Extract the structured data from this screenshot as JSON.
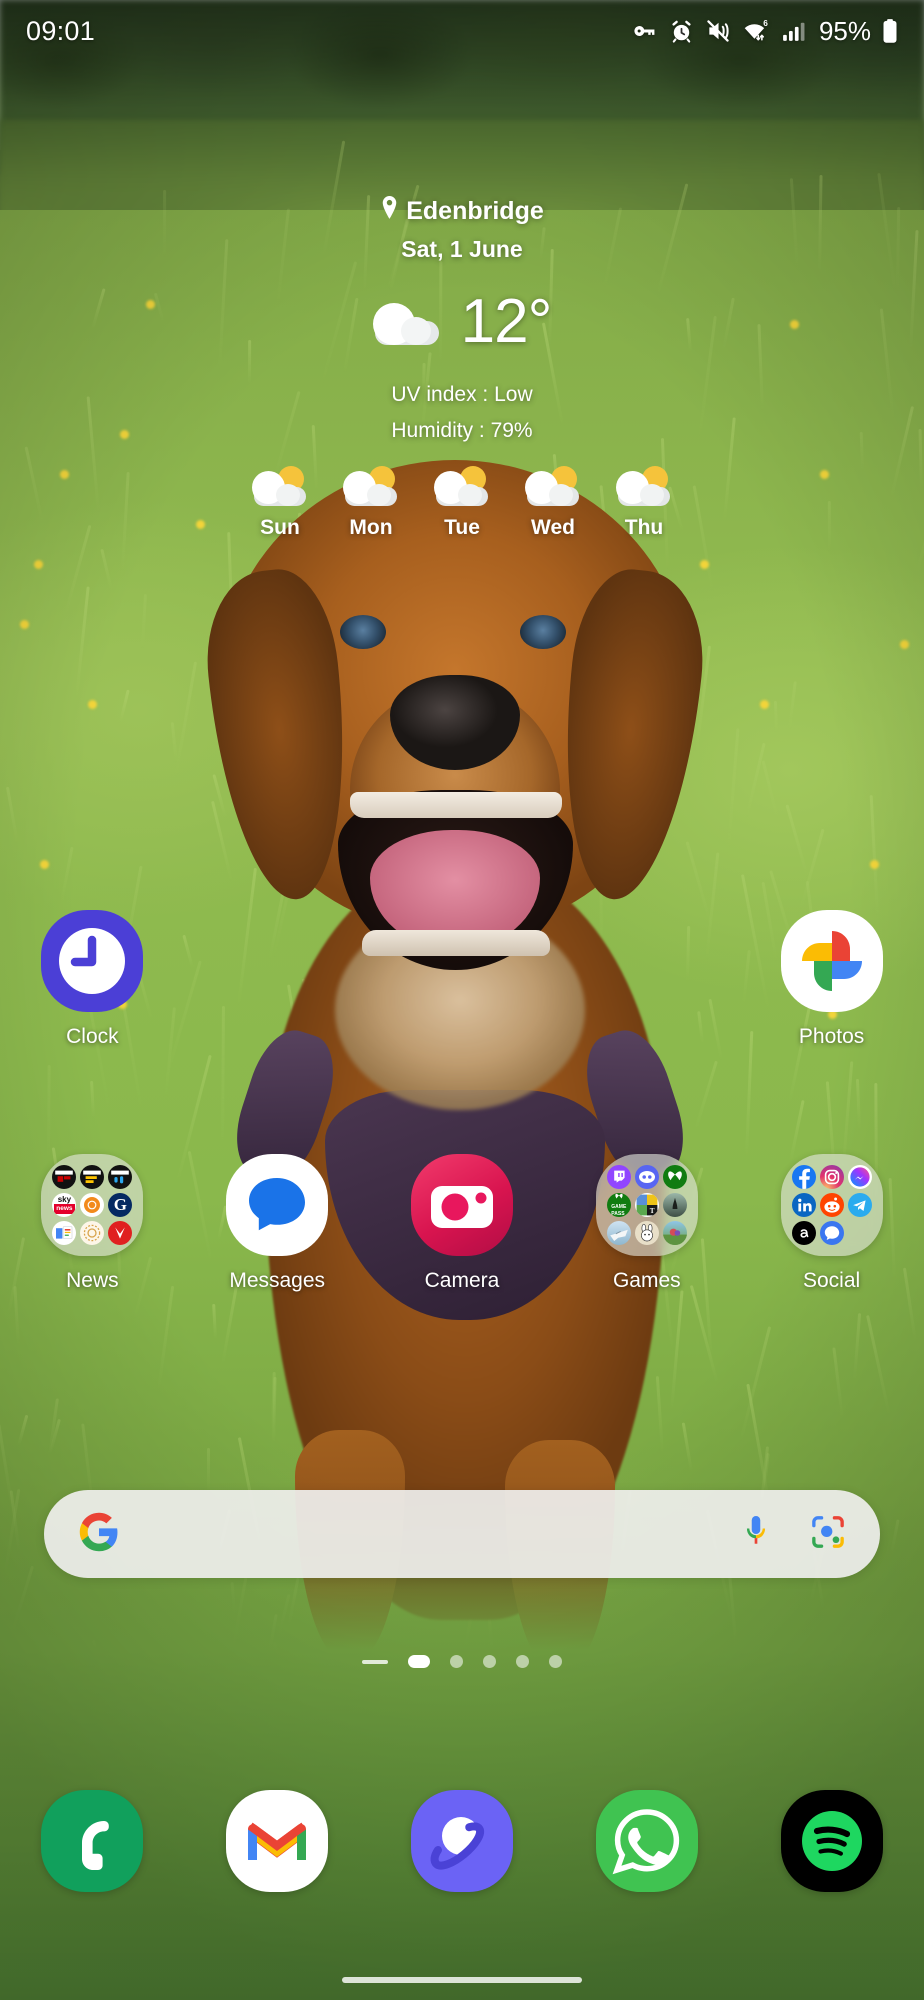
{
  "status_bar": {
    "time": "09:01",
    "battery_percent": "95%",
    "icons": [
      "vpn-key-icon",
      "alarm-icon",
      "mute-vibrate-icon",
      "wifi-6-icon",
      "signal-bars-icon",
      "battery-icon"
    ]
  },
  "weather": {
    "location": "Edenbridge",
    "location_icon": "location-pin-icon",
    "date": "Sat, 1 June",
    "temperature": "12°",
    "condition_icon": "cloudy-icon",
    "uv_index": "UV index : Low",
    "humidity": "Humidity : 79%",
    "forecast": [
      {
        "day": "Sun",
        "icon": "partly-cloudy-icon"
      },
      {
        "day": "Mon",
        "icon": "partly-cloudy-icon"
      },
      {
        "day": "Tue",
        "icon": "partly-cloudy-icon"
      },
      {
        "day": "Wed",
        "icon": "partly-cloudy-icon"
      },
      {
        "day": "Thu",
        "icon": "partly-cloudy-icon"
      }
    ]
  },
  "app_grid": {
    "row1": [
      {
        "label": "Clock",
        "icon": "clock-app-icon",
        "type": "app"
      },
      {
        "label": "",
        "icon": "",
        "type": "empty"
      },
      {
        "label": "",
        "icon": "",
        "type": "empty"
      },
      {
        "label": "",
        "icon": "",
        "type": "empty"
      },
      {
        "label": "Photos",
        "icon": "google-photos-icon",
        "type": "app"
      }
    ],
    "row2": [
      {
        "label": "News",
        "icon": "news-folder",
        "type": "folder",
        "contents": [
          "bbc-news-icon",
          "bbc-sport-icon",
          "bbc-sounds-icon",
          "sky-news-icon",
          "sunburst-icon",
          "guardian-icon",
          "google-news-icon",
          "beige-app-icon",
          "red-bird-icon"
        ]
      },
      {
        "label": "Messages",
        "icon": "google-messages-icon",
        "type": "app"
      },
      {
        "label": "Camera",
        "icon": "camera-app-icon",
        "type": "app"
      },
      {
        "label": "Games",
        "icon": "games-folder",
        "type": "folder",
        "contents": [
          "twitch-icon",
          "discord-icon",
          "xbox-icon",
          "xbox-game-pass-icon",
          "nyt-games-icon",
          "dark-game-icon",
          "plane-game-icon",
          "bunny-game-icon",
          "landscape-game-icon"
        ]
      },
      {
        "label": "Social",
        "icon": "social-folder",
        "type": "folder",
        "contents": [
          "facebook-icon",
          "instagram-icon",
          "messenger-icon",
          "linkedin-icon",
          "reddit-icon",
          "telegram-icon",
          "threads-icon",
          "signal-icon"
        ]
      }
    ]
  },
  "search": {
    "google_logo": "google-g-icon",
    "mic_icon": "microphone-icon",
    "lens_icon": "google-lens-icon",
    "placeholder": ""
  },
  "page_indicator": {
    "total_pages": 5,
    "current_page": 1,
    "home_marker": "home-page-marker"
  },
  "dock": [
    {
      "label": "Phone",
      "icon": "phone-app-icon"
    },
    {
      "label": "Gmail",
      "icon": "gmail-icon"
    },
    {
      "label": "Samsung Internet",
      "icon": "samsung-internet-icon"
    },
    {
      "label": "WhatsApp",
      "icon": "whatsapp-icon"
    },
    {
      "label": "Spotify",
      "icon": "spotify-icon"
    }
  ],
  "nav_bar": {
    "handle": "gesture-handle"
  },
  "colors": {
    "clock_bg": "#4b3fd6",
    "messages_blue": "#1a73e8",
    "camera_pink": "#e8175d",
    "whatsapp_green": "#25d366",
    "spotify_green": "#1ed760",
    "phone_green": "#11a05c",
    "samsung_purple": "#6b63f5",
    "text_white": "#ffffff"
  }
}
